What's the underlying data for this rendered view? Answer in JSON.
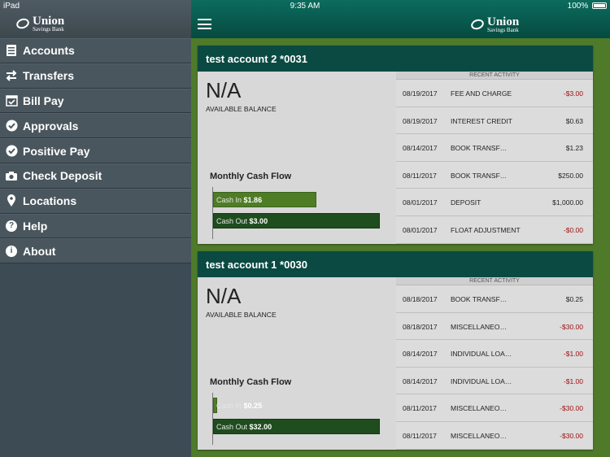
{
  "status_bar": {
    "device": "iPad",
    "time": "9:35 AM",
    "battery": "100%"
  },
  "brand": {
    "name": "Union",
    "tagline": "Savings Bank"
  },
  "menu": [
    {
      "label": "Accounts",
      "icon": "accounts-icon"
    },
    {
      "label": "Transfers",
      "icon": "transfers-icon"
    },
    {
      "label": "Bill Pay",
      "icon": "calendar-check-icon"
    },
    {
      "label": "Approvals",
      "icon": "check-circle-icon"
    },
    {
      "label": "Positive Pay",
      "icon": "check-circle-icon"
    },
    {
      "label": "Check Deposit",
      "icon": "camera-icon"
    },
    {
      "label": "Locations",
      "icon": "location-pin-icon"
    },
    {
      "label": "Help",
      "icon": "question-circle-icon"
    },
    {
      "label": "About",
      "icon": "info-circle-icon"
    }
  ],
  "accounts": [
    {
      "title": "test account 2 *0031",
      "balance": "N/A",
      "balance_label": "AVAILABLE BALANCE",
      "cash_flow_title": "Monthly Cash Flow",
      "cash_in_label": "Cash In",
      "cash_in_value": "$1.86",
      "cash_out_label": "Cash Out",
      "cash_out_value": "$3.00",
      "cash_in_fraction": 0.62,
      "cash_out_fraction": 1.0,
      "recent_activity_label": "RECENT ACTIVITY",
      "activity": [
        {
          "date": "08/19/2017",
          "desc": "FEE AND CHARGE",
          "amount": "-$3.00",
          "negative": true
        },
        {
          "date": "08/19/2017",
          "desc": "INTEREST CREDIT",
          "amount": "$0.63",
          "negative": false
        },
        {
          "date": "08/14/2017",
          "desc": "BOOK TRANSF…",
          "amount": "$1.23",
          "negative": false
        },
        {
          "date": "08/11/2017",
          "desc": "BOOK TRANSF…",
          "amount": "$250.00",
          "negative": false
        },
        {
          "date": "08/01/2017",
          "desc": "DEPOSIT",
          "amount": "$1,000.00",
          "negative": false
        },
        {
          "date": "08/01/2017",
          "desc": "FLOAT ADJUSTMENT",
          "amount": "-$0.00",
          "negative": true
        }
      ]
    },
    {
      "title": "test account 1 *0030",
      "balance": "N/A",
      "balance_label": "AVAILABLE BALANCE",
      "cash_flow_title": "Monthly Cash Flow",
      "cash_in_label": "Cash In",
      "cash_in_value": "$0.25",
      "cash_out_label": "Cash Out",
      "cash_out_value": "$32.00",
      "cash_in_fraction": 0.01,
      "cash_out_fraction": 1.0,
      "recent_activity_label": "RECENT ACTIVITY",
      "activity": [
        {
          "date": "08/18/2017",
          "desc": "BOOK TRANSF…",
          "amount": "$0.25",
          "negative": false
        },
        {
          "date": "08/18/2017",
          "desc": "MISCELLANEO…",
          "amount": "-$30.00",
          "negative": true
        },
        {
          "date": "08/14/2017",
          "desc": "INDIVIDUAL LOA…",
          "amount": "-$1.00",
          "negative": true
        },
        {
          "date": "08/14/2017",
          "desc": "INDIVIDUAL LOA…",
          "amount": "-$1.00",
          "negative": true
        },
        {
          "date": "08/11/2017",
          "desc": "MISCELLANEO…",
          "amount": "-$30.00",
          "negative": true
        },
        {
          "date": "08/11/2017",
          "desc": "MISCELLANEO…",
          "amount": "-$30.00",
          "negative": true
        }
      ]
    }
  ],
  "colors": {
    "header_teal": "#0a4a42",
    "sidebar": "#4a565e",
    "background_green": "#4e7a2a",
    "negative": "#a01010"
  }
}
